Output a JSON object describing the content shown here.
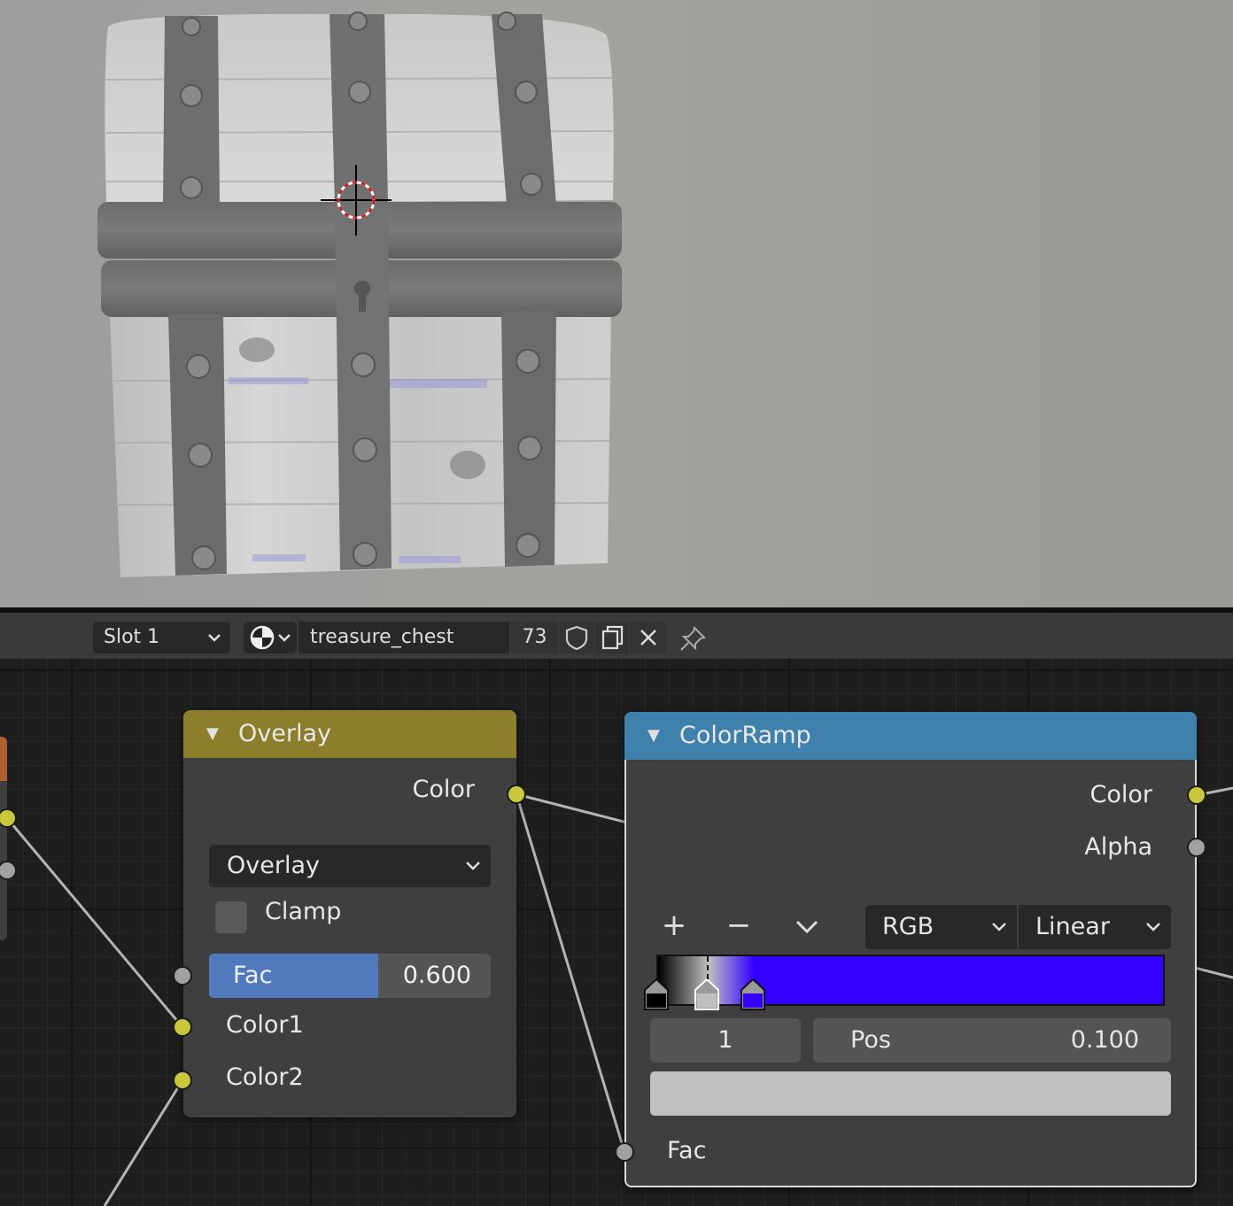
{
  "header": {
    "slot_label": "Slot 1",
    "material_name": "treasure_chest",
    "user_count": "73"
  },
  "overlay_node": {
    "title": "Overlay",
    "output_color": "Color",
    "blend_mode": "Overlay",
    "clamp_label": "Clamp",
    "clamp_checked": false,
    "fac_label": "Fac",
    "fac_value": "0.600",
    "fac_fraction": 0.6,
    "input_color1": "Color1",
    "input_color2": "Color2",
    "header_color": "#8c7e2b"
  },
  "colorramp_node": {
    "title": "ColorRamp",
    "output_color": "Color",
    "output_alpha": "Alpha",
    "add_symbol": "+",
    "remove_symbol": "−",
    "color_mode": "RGB",
    "interpolation": "Linear",
    "active_stop_index": "1",
    "pos_label": "Pos",
    "pos_value": "0.100",
    "active_stop_color": "#c0c0c0",
    "input_fac": "Fac",
    "header_color": "#3f81ad",
    "stops": [
      {
        "position": 0.0,
        "color": "#000000"
      },
      {
        "position": 0.1,
        "color": "#c0c0c0"
      },
      {
        "position": 0.19,
        "color": "#3300ff"
      }
    ]
  },
  "colors": {
    "socket_color": "#c8c83a",
    "socket_float": "#a1a1a1",
    "editor_background": "#1e1e1e"
  }
}
